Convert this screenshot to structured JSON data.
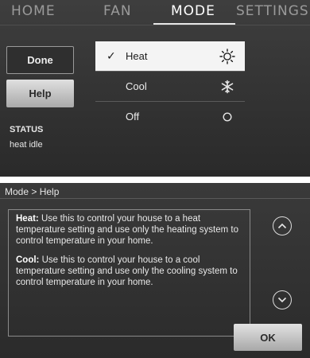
{
  "tabs": [
    {
      "label": "HOME",
      "active": false
    },
    {
      "label": "FAN",
      "active": false
    },
    {
      "label": "MODE",
      "active": true
    },
    {
      "label": "SETTINGS",
      "active": false
    }
  ],
  "buttons": {
    "done": "Done",
    "help": "Help"
  },
  "status": {
    "label": "STATUS",
    "value": "heat idle"
  },
  "modes": [
    {
      "label": "Heat",
      "selected": true,
      "check": "✓",
      "icon": "sun-icon"
    },
    {
      "label": "Cool",
      "selected": false,
      "icon": "snowflake-icon"
    },
    {
      "label": "Off",
      "selected": false,
      "icon": "circle-icon"
    }
  ],
  "help_screen": {
    "breadcrumb": "Mode > Help",
    "heat_title": "Heat:",
    "heat_text": "Use this to control your house to a heat temperature setting and use only the heating system to control temperature in your home.",
    "cool_title": "Cool:",
    "cool_text": "Use this to control your house to a cool temperature setting and use only the cooling system to control temperature in your home.",
    "ok_label": "OK"
  },
  "colors": {
    "background": "#333333",
    "selected_row": "#f4f4f4",
    "text": "#e6e6e6"
  }
}
